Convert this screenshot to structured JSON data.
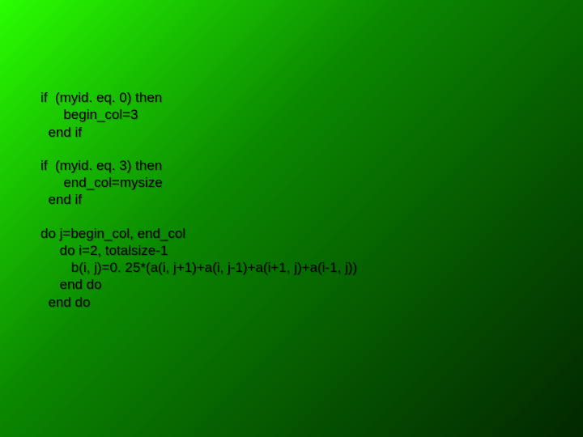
{
  "code": {
    "block1_line1": "if  (myid. eq. 0) then",
    "block1_line2": "      begin_col=3",
    "block1_line3": "  end if",
    "block2_line1": "if  (myid. eq. 3) then",
    "block2_line2": "      end_col=mysize",
    "block2_line3": "  end if",
    "block3_line1": "do j=begin_col, end_col",
    "block3_line2": "     do i=2, totalsize-1",
    "block3_line3": "        b(i, j)=0. 25*(a(i, j+1)+a(i, j-1)+a(i+1, j)+a(i-1, j))",
    "block3_line4": "     end do",
    "block3_line5": "  end do"
  }
}
